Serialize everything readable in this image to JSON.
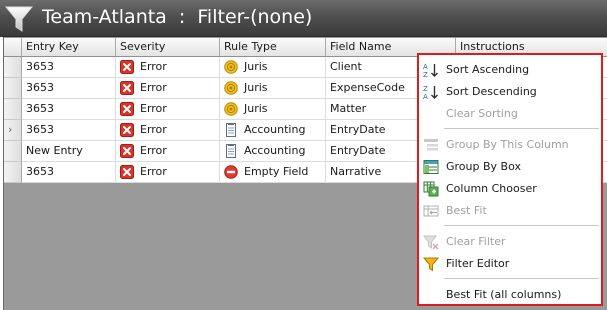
{
  "title": {
    "text": "Team-Atlanta  :  Filter-(none)",
    "icon": "funnel-icon"
  },
  "columns": [
    "Entry Key",
    "Severity",
    "Rule Type",
    "Field Name",
    "Instructions"
  ],
  "rows": [
    {
      "entry_key": "3653",
      "severity": "Error",
      "severity_icon": "error-icon",
      "rule_type": "Juris",
      "rule_icon": "coin-icon",
      "field_name": "Client",
      "current": false
    },
    {
      "entry_key": "3653",
      "severity": "Error",
      "severity_icon": "error-icon",
      "rule_type": "Juris",
      "rule_icon": "coin-icon",
      "field_name": "ExpenseCode",
      "current": false
    },
    {
      "entry_key": "3653",
      "severity": "Error",
      "severity_icon": "error-icon",
      "rule_type": "Juris",
      "rule_icon": "coin-icon",
      "field_name": "Matter",
      "current": false
    },
    {
      "entry_key": "3653",
      "severity": "Error",
      "severity_icon": "error-icon",
      "rule_type": "Accounting",
      "rule_icon": "ledger-icon",
      "field_name": "EntryDate",
      "current": true
    },
    {
      "entry_key": "New Entry",
      "severity": "Error",
      "severity_icon": "error-icon",
      "rule_type": "Accounting",
      "rule_icon": "ledger-icon",
      "field_name": "EntryDate",
      "current": false
    },
    {
      "entry_key": "3653",
      "severity": "Error",
      "severity_icon": "error-icon",
      "rule_type": "Empty Field",
      "rule_icon": "no-entry-icon",
      "field_name": "Narrative",
      "current": false
    }
  ],
  "context_menu": {
    "items": [
      {
        "label": "Sort Ascending",
        "icon": "sort-ascending-icon",
        "enabled": true
      },
      {
        "label": "Sort Descending",
        "icon": "sort-descending-icon",
        "enabled": true
      },
      {
        "label": "Clear Sorting",
        "icon": "",
        "enabled": false
      },
      {
        "label": "Group By This Column",
        "icon": "group-by-column-icon",
        "enabled": false
      },
      {
        "label": "Group By Box",
        "icon": "group-by-box-icon",
        "enabled": true
      },
      {
        "label": "Column Chooser",
        "icon": "column-chooser-icon",
        "enabled": true
      },
      {
        "label": "Best Fit",
        "icon": "best-fit-icon",
        "enabled": false
      },
      {
        "label": "Clear Filter",
        "icon": "clear-filter-icon",
        "enabled": false
      },
      {
        "label": "Filter Editor",
        "icon": "filter-editor-icon",
        "enabled": true
      },
      {
        "label": "Best Fit (all columns)",
        "icon": "",
        "enabled": true
      }
    ]
  },
  "colors": {
    "titlebar": "#4f4f4f",
    "menu_highlight_border": "#e01b1b",
    "error_red": "#d9342b",
    "disabled_text": "#a0a0a0"
  }
}
